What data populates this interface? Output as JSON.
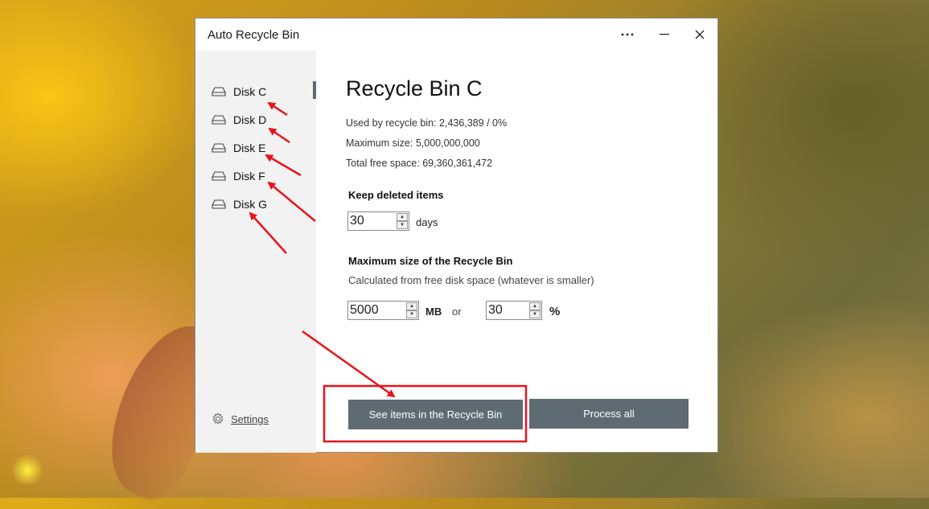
{
  "window": {
    "title": "Auto Recycle Bin"
  },
  "sidebar": {
    "items": [
      {
        "label": "Disk C"
      },
      {
        "label": "Disk D"
      },
      {
        "label": "Disk E"
      },
      {
        "label": "Disk F"
      },
      {
        "label": "Disk G"
      }
    ],
    "selected": "Disk C",
    "settings_label": "Settings"
  },
  "main": {
    "title": "Recycle Bin C",
    "used": "Used by recycle bin: 2,436,389 / 0%",
    "max_size": "Maximum size: 5,000,000,000",
    "free_space": "Total free space: 69,360,361,472",
    "keep_heading": "Keep deleted items",
    "keep_value": "30",
    "keep_unit": "days",
    "max_heading": "Maximum size of the Recycle Bin",
    "max_sub": "Calculated from free disk space (whatever is smaller)",
    "mb_value": "5000",
    "mb_unit": "MB",
    "or_label": "or",
    "pct_value": "30",
    "pct_unit": "%",
    "see_items_label": "See items in the Recycle Bin",
    "process_all_label": "Process all"
  },
  "colors": {
    "button": "#5f6b73",
    "sidebar_bg": "#f2f2f2",
    "annotation": "#e8141c"
  },
  "icons": [
    "more-icon",
    "minimize-icon",
    "close-icon",
    "drive-icon",
    "gear-icon",
    "spin-up-icon",
    "spin-down-icon"
  ]
}
